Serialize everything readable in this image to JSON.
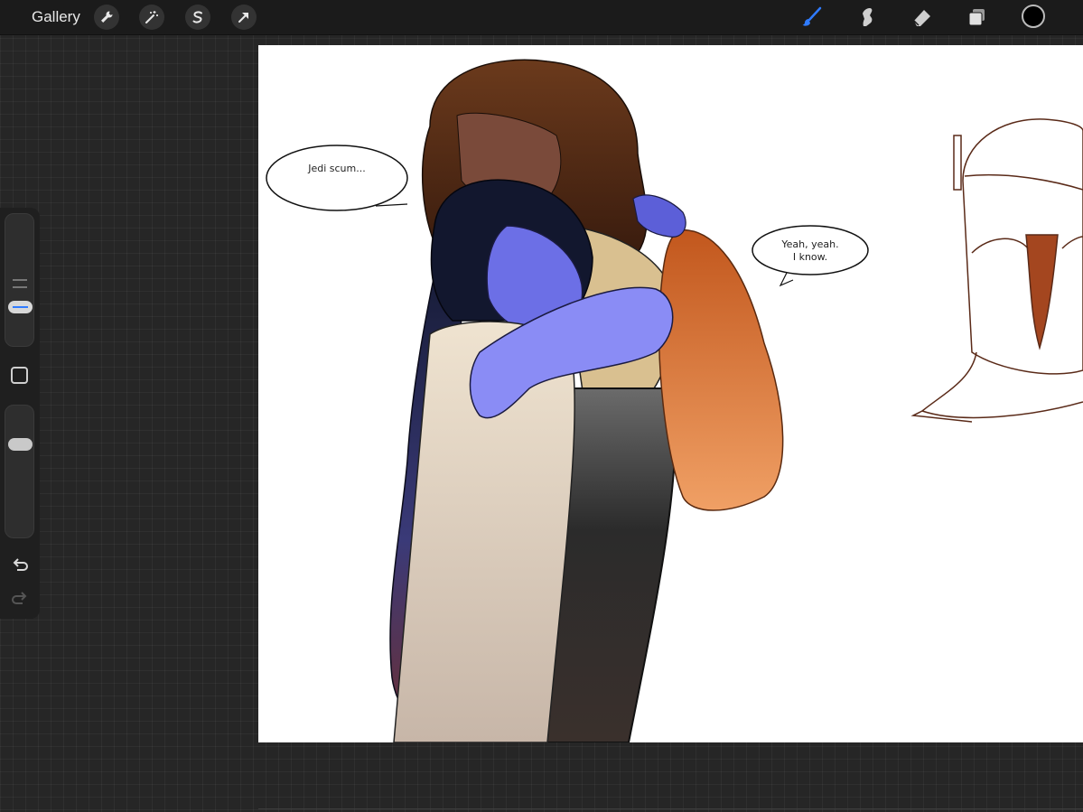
{
  "topbar": {
    "gallery_label": "Gallery",
    "left_tools": [
      {
        "icon": "wrench-icon",
        "name": "actions"
      },
      {
        "icon": "magic-wand-icon",
        "name": "adjustments"
      },
      {
        "icon": "selection-s-icon",
        "name": "selection"
      },
      {
        "icon": "transform-arrow-icon",
        "name": "transform"
      }
    ],
    "right_tools": [
      {
        "icon": "brush-icon",
        "name": "paint",
        "active": true
      },
      {
        "icon": "smudge-icon",
        "name": "smudge",
        "active": false
      },
      {
        "icon": "eraser-icon",
        "name": "erase",
        "active": false
      },
      {
        "icon": "layers-icon",
        "name": "layers",
        "active": false
      }
    ],
    "active_color": "#000000",
    "active_tool_color": "#2f7bff"
  },
  "sidebar": {
    "brush_size_level": 0.25,
    "opacity_level": 0.7
  },
  "canvas": {
    "speech_bubbles": [
      {
        "text": "Jedi scum..."
      },
      {
        "line1": "Yeah, yeah.",
        "line2": "I know."
      }
    ]
  }
}
